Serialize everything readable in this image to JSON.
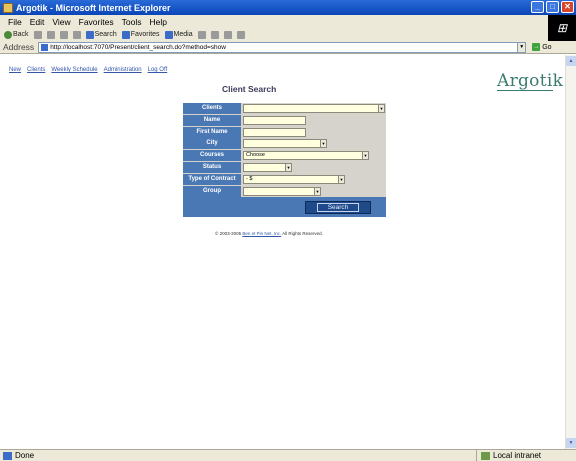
{
  "window": {
    "title": "Argotik - Microsoft Internet Explorer",
    "min": "_",
    "max": "□",
    "close": "✕"
  },
  "menu": [
    "File",
    "Edit",
    "View",
    "Favorites",
    "Tools",
    "Help"
  ],
  "toolbar": {
    "back": "Back",
    "search": "Search",
    "favorites": "Favorites",
    "media": "Media"
  },
  "address": {
    "label": "Address",
    "url": "http://localhost:7070/Present/client_search.do?method=show",
    "go": "Go"
  },
  "nav": [
    "New",
    "Clients",
    "Weekly Schedule",
    "Administration",
    "Log Off"
  ],
  "logo": "Argotik",
  "page_title": "Client Search",
  "form": {
    "rows": [
      {
        "label": "Clients",
        "value": "",
        "select": true
      },
      {
        "label": "Name",
        "value": "",
        "select": false
      },
      {
        "label": "First Name",
        "value": "",
        "select": false
      },
      {
        "label": "City",
        "value": "",
        "select": true
      },
      {
        "label": "Courses",
        "value": "Choose",
        "select": true
      },
      {
        "label": "Status",
        "value": "",
        "select": true
      },
      {
        "label": "Type of Contract",
        "value": "- $",
        "select": true
      },
      {
        "label": "Group",
        "value": "",
        "select": true
      }
    ],
    "search_button": "Search"
  },
  "copyright": {
    "prefix": "© 2003-2005",
    "link": "Ben et Pin Net, Inc.",
    "suffix": "All Rights Reserved."
  },
  "status": {
    "text": "Done",
    "zone": "Local intranet"
  }
}
